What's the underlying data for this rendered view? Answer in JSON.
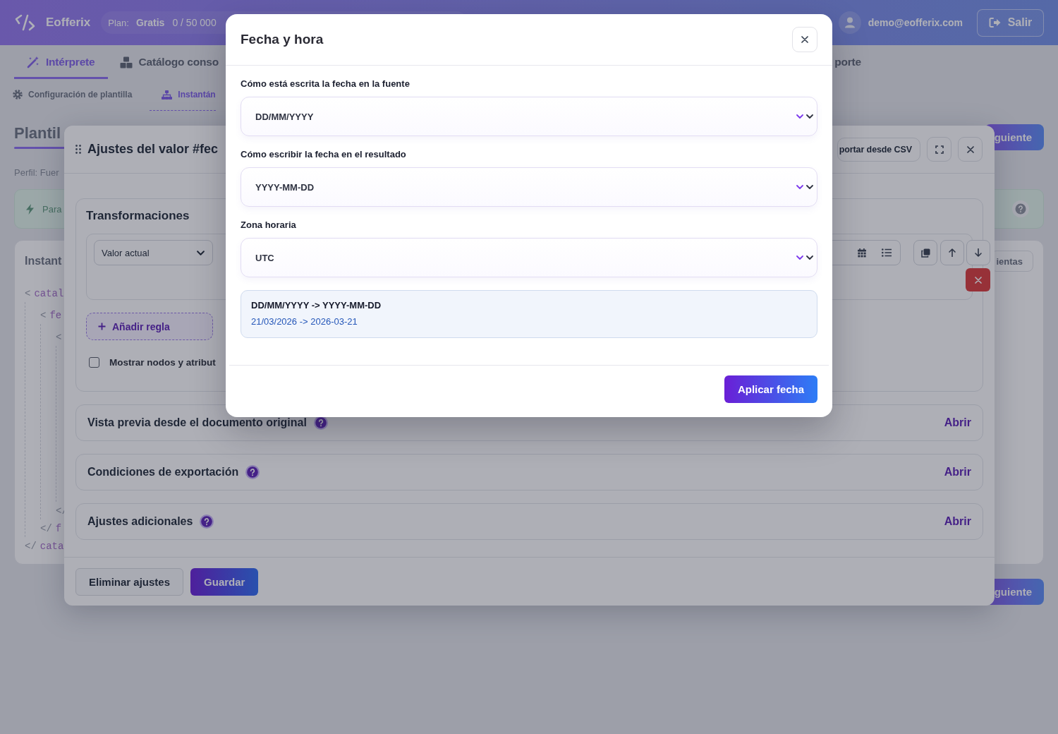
{
  "header": {
    "brand": "Eofferix",
    "plan": {
      "label": "Plan:",
      "name": "Gratis",
      "usage": "0 / 50 000"
    },
    "user_email": "demo@eofferix.com",
    "logout_button": "Salir"
  },
  "nav_tabs": [
    {
      "label": "Intérprete",
      "selected": true
    },
    {
      "label": "Catálogo conso",
      "selected": false
    },
    {
      "label": "porte",
      "selected": false
    }
  ],
  "sub_tabs": [
    {
      "label": "Configuración de plantilla",
      "selected": false
    },
    {
      "label": "Instantán",
      "selected": true
    }
  ],
  "page": {
    "title": "Plantil",
    "next_button": "guiente",
    "profile": "Perfil: Fuer",
    "banner": "Para",
    "card": {
      "title": "Instant",
      "tools_button": "ientas",
      "code_tree": [
        {
          "open": {
            "bracket": "<",
            "tag": "catal"
          },
          "close": {
            "bracket": "</",
            "tag": "cata"
          },
          "children": [
            {
              "open": {
                "bracket": "<",
                "tag": "fe"
              },
              "close": {
                "bracket": "</",
                "tag": "f"
              },
              "children": [
                {
                  "open": {
                    "bracket": "<"
                  },
                  "close": {
                    "bracket": "</"
                  }
                }
              ]
            }
          ]
        }
      ]
    },
    "bottom_next_button": "guiente"
  },
  "value_settings": {
    "title": "Ajustes del valor #fec",
    "import_button": "portar desde CSV",
    "transformations": {
      "title": "Transformaciones",
      "rule": {
        "source_select": "Valor actual"
      },
      "add_rule_button": "Añadir regla",
      "show_nodes": {
        "label": "Mostrar nodos y atribut",
        "checked": false
      }
    },
    "sections": [
      {
        "title": "Vista previa desde el documento original",
        "action": "Abrir"
      },
      {
        "title": "Condiciones de exportación",
        "action": "Abrir"
      },
      {
        "title": "Ajustes adicionales",
        "action": "Abrir"
      }
    ],
    "footer": {
      "delete_button": "Eliminar ajustes",
      "save_button": "Guardar"
    }
  },
  "date_dialog": {
    "title": "Fecha y hora",
    "fields": [
      {
        "label": "Cómo está escrita la fecha en la fuente",
        "value": "DD/MM/YYYY"
      },
      {
        "label": "Cómo escribir la fecha en el resultado",
        "value": "YYYY-MM-DD"
      },
      {
        "label": "Zona horaria",
        "value": "UTC"
      }
    ],
    "preview": {
      "pattern": "DD/MM/YYYY -> YYYY-MM-DD",
      "example": "21/03/2026 -> 2026-03-21"
    },
    "apply_button": "Aplicar fecha"
  }
}
